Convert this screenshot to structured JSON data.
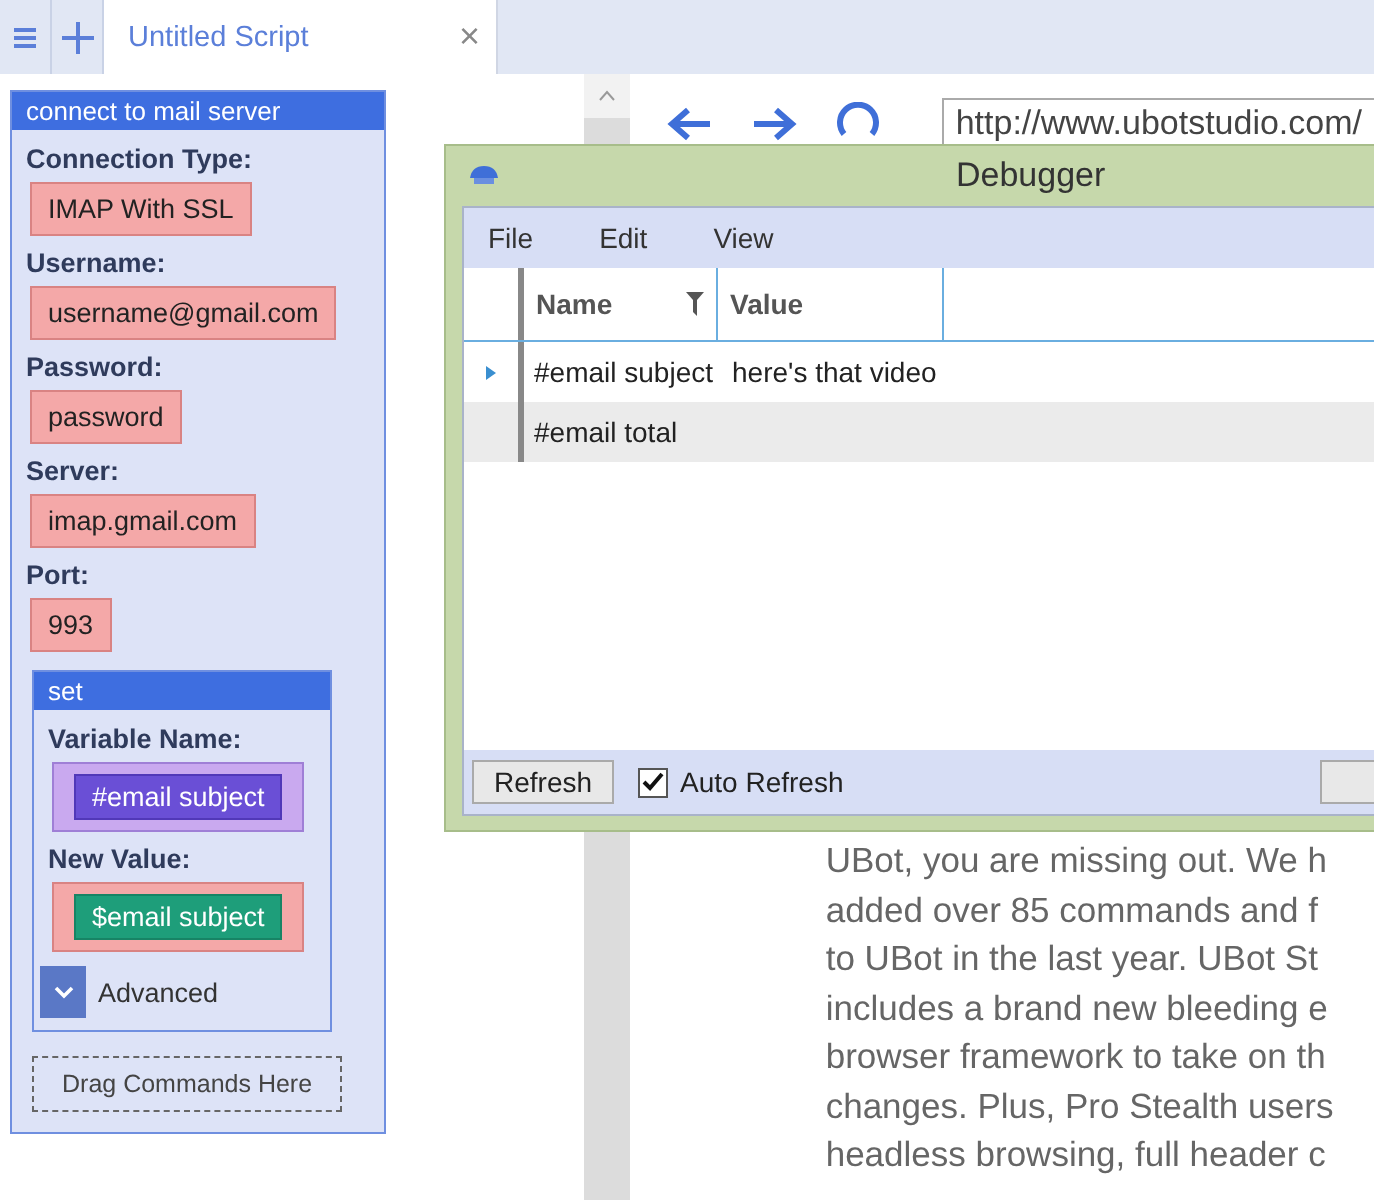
{
  "tab": {
    "title": "Untitled Script",
    "close": "×"
  },
  "command": {
    "title": "connect to mail server",
    "params": [
      {
        "label": "Connection Type:",
        "value": "IMAP With SSL",
        "kind": "text"
      },
      {
        "label": "Username:",
        "value": "username@gmail.com",
        "kind": "text"
      },
      {
        "label": "Password:",
        "value": "password",
        "kind": "text"
      },
      {
        "label": "Server:",
        "value": "imap.gmail.com",
        "kind": "text"
      },
      {
        "label": "Port:",
        "value": "993",
        "kind": "text"
      }
    ],
    "child": {
      "title": "set",
      "params": [
        {
          "label": "Variable Name:",
          "value": "#email subject",
          "kind": "variable"
        },
        {
          "label": "New Value:",
          "value": "$email subject",
          "kind": "string"
        }
      ],
      "advanced": "Advanced"
    },
    "drop_hint": "Drag Commands Here"
  },
  "browser": {
    "url": "http://www.ubotstudio.com/",
    "lines": [
      "UBot, you are missing out. We h",
      "added over 85 commands and f",
      "to UBot in the last year. UBot St",
      "includes a brand new bleeding e",
      "browser framework to take on th",
      "changes. Plus, Pro Stealth users",
      "headless browsing, full header c"
    ]
  },
  "debugger": {
    "title": "Debugger",
    "menu": [
      "File",
      "Edit",
      "View"
    ],
    "columns": [
      {
        "label": "Name",
        "filter": true
      },
      {
        "label": "Value",
        "filter": false
      }
    ],
    "rows": [
      {
        "name": "#email subject",
        "value": "here's that video",
        "current": true
      },
      {
        "name": "#email total",
        "current": false
      }
    ],
    "refresh": "Refresh",
    "auto_refresh": {
      "label": "Auto Refresh",
      "checked": true
    }
  }
}
